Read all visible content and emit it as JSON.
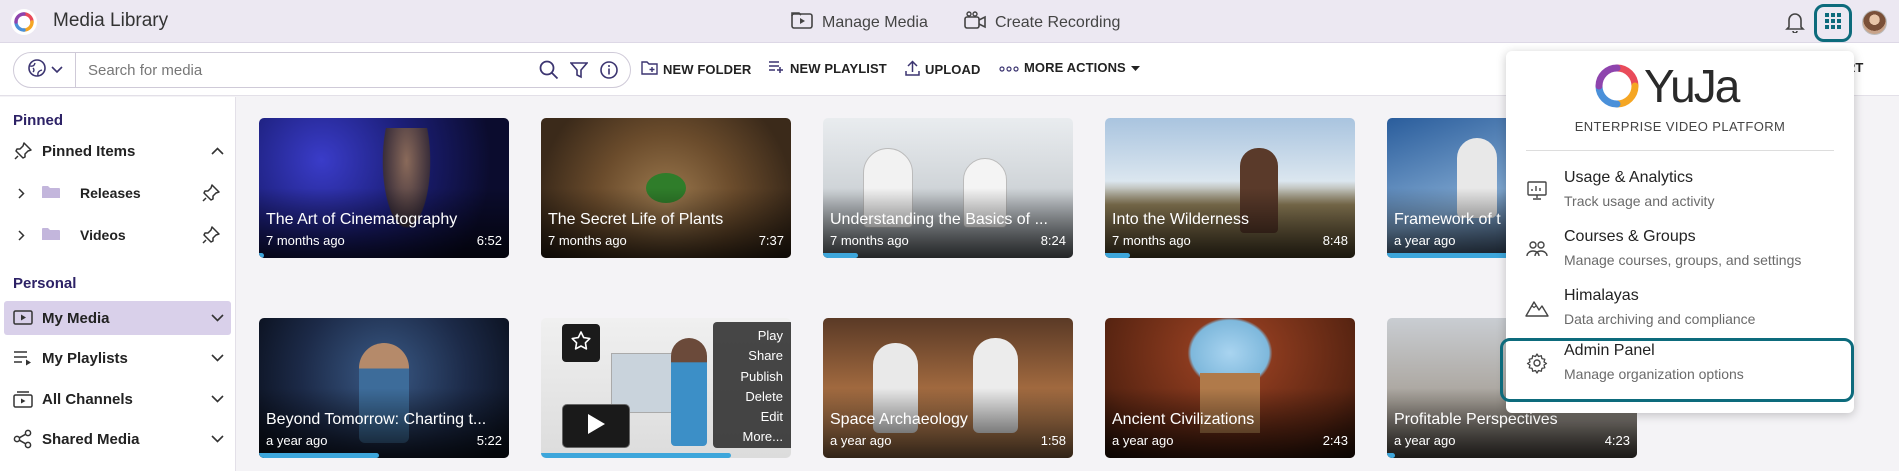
{
  "app": {
    "title": "Media Library"
  },
  "nav": {
    "manage_media": "Manage Media",
    "create_recording": "Create Recording"
  },
  "search": {
    "placeholder": "Search for media"
  },
  "toolbar": {
    "new_folder": "NEW FOLDER",
    "new_playlist": "NEW PLAYLIST",
    "upload": "UPLOAD",
    "more_actions": "MORE ACTIONS",
    "cut_text": "RT"
  },
  "sidebar": {
    "pinned_heading": "Pinned",
    "pinned_items": "Pinned Items",
    "releases": "Releases",
    "videos": "Videos",
    "personal_heading": "Personal",
    "my_media": "My Media",
    "my_playlists": "My Playlists",
    "all_channels": "All Channels",
    "shared_media": "Shared Media"
  },
  "cards": [
    {
      "title": "The Art of Cinematography",
      "date": "7 months ago",
      "duration": "6:52",
      "progress": 0.02
    },
    {
      "title": "The Secret Life of Plants",
      "date": "7 months ago",
      "duration": "7:37",
      "progress": 0.0
    },
    {
      "title": "Understanding the Basics of ...",
      "date": "7 months ago",
      "duration": "8:24",
      "progress": 0.14
    },
    {
      "title": "Into the Wilderness",
      "date": "7 months ago",
      "duration": "8:48",
      "progress": 0.1
    },
    {
      "title": "Framework of t",
      "date": "a year ago",
      "duration": "",
      "progress": 0.85
    },
    {
      "title": "Beyond Tomorrow: Charting t...",
      "date": "a year ago",
      "duration": "5:22",
      "progress": 0.48
    },
    {
      "title": "",
      "date": "",
      "duration": "",
      "progress": 0.76
    },
    {
      "title": "Space Archaeology",
      "date": "a year ago",
      "duration": "1:58",
      "progress": 0.0
    },
    {
      "title": "Ancient Civilizations",
      "date": "a year ago",
      "duration": "2:43",
      "progress": 0.0
    },
    {
      "title": "Profitable Perspectives",
      "date": "a year ago",
      "duration": "4:23",
      "progress": 0.03
    }
  ],
  "hover_menu": [
    "Play",
    "Share",
    "Publish",
    "Delete",
    "Edit",
    "More..."
  ],
  "dropdown": {
    "brand": "YuJa",
    "tagline": "ENTERPRISE VIDEO PLATFORM",
    "items": [
      {
        "title": "Usage & Analytics",
        "desc": "Track usage and activity"
      },
      {
        "title": "Courses & Groups",
        "desc": "Manage courses, groups, and settings"
      },
      {
        "title": "Himalayas",
        "desc": "Data archiving and compliance"
      },
      {
        "title": "Admin Panel",
        "desc": "Manage organization options"
      }
    ]
  },
  "colors": {
    "accent_teal": "#0d6b7c",
    "brand_purple": "#2d2266",
    "progress_blue": "#3da6db"
  }
}
